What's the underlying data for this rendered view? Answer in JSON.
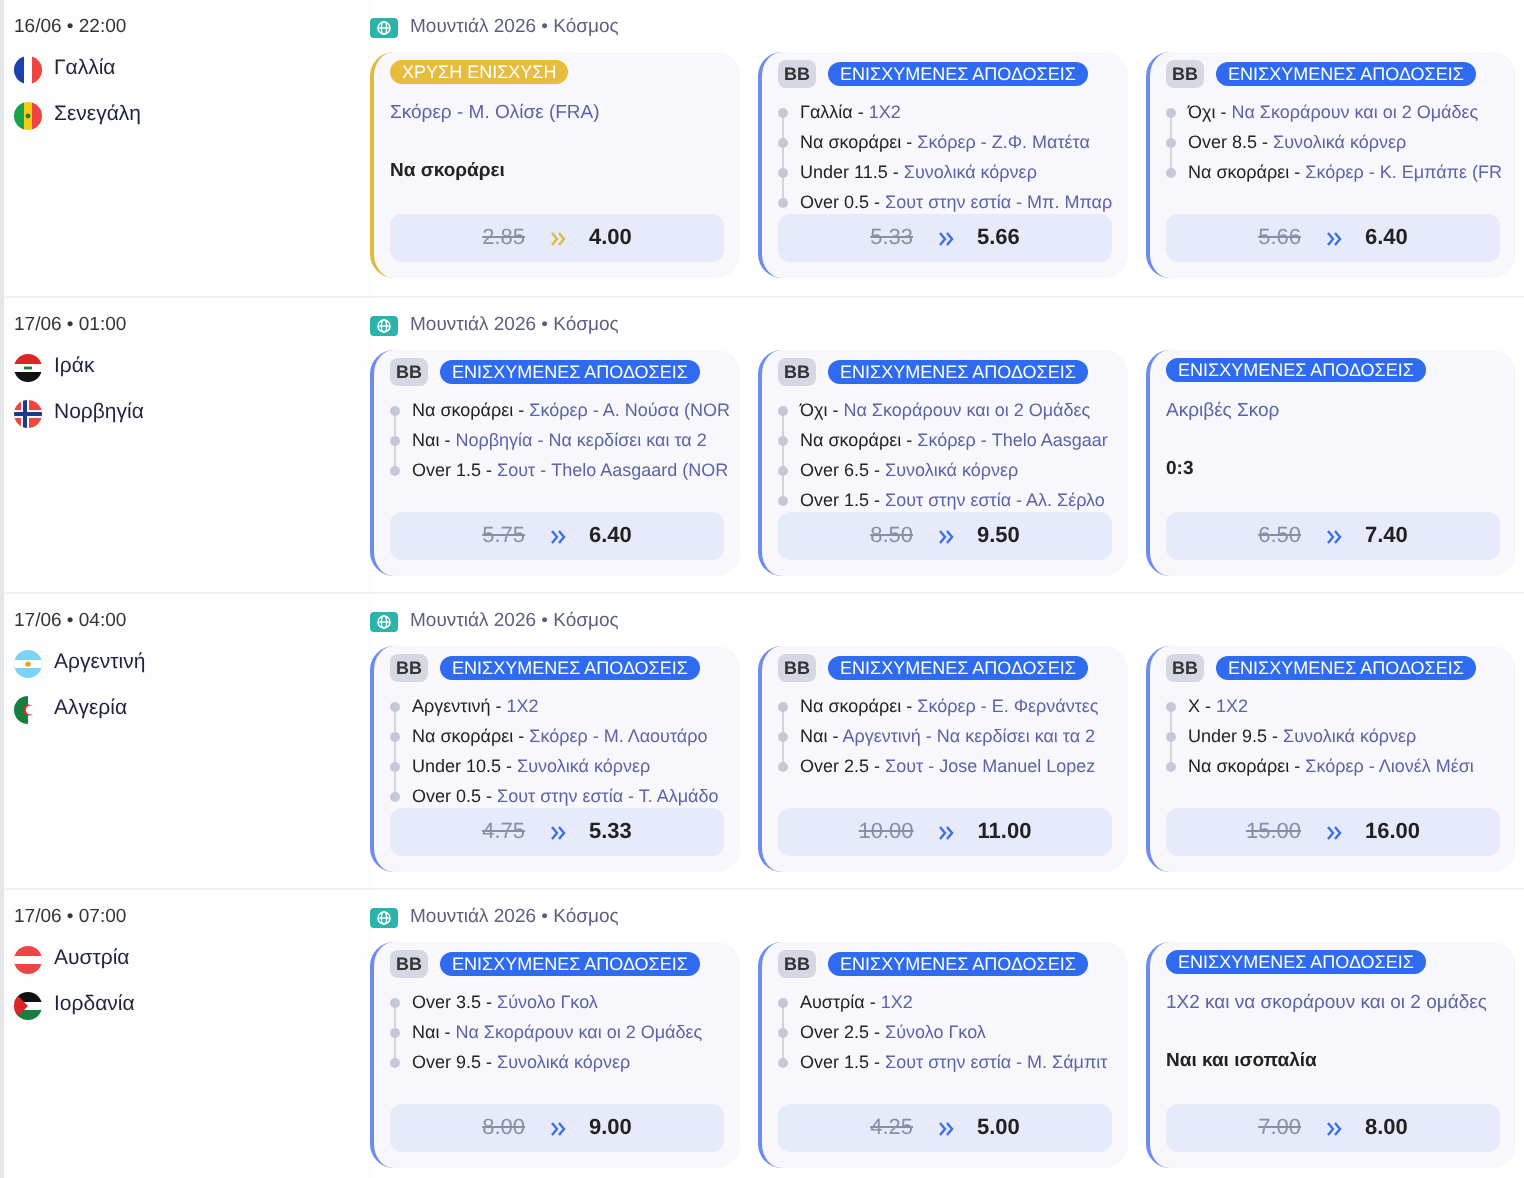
{
  "matches": [
    {
      "date": "16/06 • 22:00",
      "teams": [
        {
          "name": "Γαλλία",
          "kind": "fr"
        },
        {
          "name": "Σενεγάλη",
          "kind": "sn"
        }
      ],
      "competition": "Μουντιάλ 2026 • Κόσμος",
      "cards": [
        {
          "kind": "golden",
          "badge": "ΧΡΥΣΗ ΕΝΙΣΧΥΣΗ",
          "market": "Σκόρερ - Μ. Ολίσε (FRA)",
          "selection": "Να σκοράρει",
          "old_odds": "2.85",
          "new_odds": "4.00"
        },
        {
          "kind": "boosted",
          "bb": "BB",
          "badge": "ΕΝΙΣΧΥΜΕΝΕΣ ΑΠΟΔΟΣΕΙΣ",
          "legs": [
            {
              "pick": "Γαλλία -",
              "market": "1X2"
            },
            {
              "pick": "Να σκοράρει -",
              "market": "Σκόρερ - Ζ.Φ. Ματέτα"
            },
            {
              "pick": "Under 11.5 -",
              "market": "Συνολικά κόρνερ"
            },
            {
              "pick": "Over 0.5 -",
              "market": "Σουτ στην εστία - Μπ. Μπαρ"
            }
          ],
          "old_odds": "5.33",
          "new_odds": "5.66"
        },
        {
          "kind": "boosted",
          "bb": "BB",
          "badge": "ΕΝΙΣΧΥΜΕΝΕΣ ΑΠΟΔΟΣΕΙΣ",
          "legs": [
            {
              "pick": "Όχι -",
              "market": "Να Σκοράρουν και οι 2 Ομάδες"
            },
            {
              "pick": "Over 8.5 -",
              "market": "Συνολικά κόρνερ"
            },
            {
              "pick": "Να σκοράρει -",
              "market": "Σκόρερ - Κ. Εμπάπε (FR"
            }
          ],
          "old_odds": "5.66",
          "new_odds": "6.40"
        }
      ]
    },
    {
      "date": "17/06 • 01:00",
      "teams": [
        {
          "name": "Ιράκ",
          "kind": "iq"
        },
        {
          "name": "Νορβηγία",
          "kind": "no"
        }
      ],
      "competition": "Μουντιάλ 2026 • Κόσμος",
      "cards": [
        {
          "kind": "boosted",
          "bb": "BB",
          "badge": "ΕΝΙΣΧΥΜΕΝΕΣ ΑΠΟΔΟΣΕΙΣ",
          "legs": [
            {
              "pick": "Να σκοράρει -",
              "market": "Σκόρερ - Α. Νούσα (NOR"
            },
            {
              "pick": "Ναι -",
              "market": "Νορβηγία - Να κερδίσει και τα 2"
            },
            {
              "pick": "Over 1.5 -",
              "market": "Σουτ - Thelo Aasgaard (NOR"
            }
          ],
          "old_odds": "5.75",
          "new_odds": "6.40"
        },
        {
          "kind": "boosted",
          "bb": "BB",
          "badge": "ΕΝΙΣΧΥΜΕΝΕΣ ΑΠΟΔΟΣΕΙΣ",
          "legs": [
            {
              "pick": "Όχι -",
              "market": "Να Σκοράρουν και οι 2 Ομάδες"
            },
            {
              "pick": "Να σκοράρει -",
              "market": "Σκόρερ - Thelo Aasgaar"
            },
            {
              "pick": "Over 6.5 -",
              "market": "Συνολικά κόρνερ"
            },
            {
              "pick": "Over 1.5 -",
              "market": "Σουτ στην εστία - Αλ. Σέρλο"
            }
          ],
          "old_odds": "8.50",
          "new_odds": "9.50"
        },
        {
          "kind": "boosted",
          "badge": "ΕΝΙΣΧΥΜΕΝΕΣ ΑΠΟΔΟΣΕΙΣ",
          "market": "Ακριβές Σκορ",
          "selection": "0:3",
          "old_odds": "6.50",
          "new_odds": "7.40"
        }
      ]
    },
    {
      "date": "17/06 • 04:00",
      "teams": [
        {
          "name": "Αργεντινή",
          "kind": "ar"
        },
        {
          "name": "Αλγερία",
          "kind": "dz"
        }
      ],
      "competition": "Μουντιάλ 2026 • Κόσμος",
      "cards": [
        {
          "kind": "boosted",
          "bb": "BB",
          "badge": "ΕΝΙΣΧΥΜΕΝΕΣ ΑΠΟΔΟΣΕΙΣ",
          "legs": [
            {
              "pick": "Αργεντινή -",
              "market": "1X2"
            },
            {
              "pick": "Να σκοράρει -",
              "market": "Σκόρερ - Μ. Λαουτάρο"
            },
            {
              "pick": "Under 10.5 -",
              "market": "Συνολικά κόρνερ"
            },
            {
              "pick": "Over 0.5 -",
              "market": "Σουτ στην εστία - Τ. Αλμάδο"
            }
          ],
          "old_odds": "4.75",
          "new_odds": "5.33"
        },
        {
          "kind": "boosted",
          "bb": "BB",
          "badge": "ΕΝΙΣΧΥΜΕΝΕΣ ΑΠΟΔΟΣΕΙΣ",
          "legs": [
            {
              "pick": "Να σκοράρει -",
              "market": "Σκόρερ - Ε. Φερνάντες"
            },
            {
              "pick": "Ναι -",
              "market": "Αργεντινή - Να κερδίσει και τα 2"
            },
            {
              "pick": "Over 2.5 -",
              "market": "Σουτ - Jose Manuel Lopez"
            }
          ],
          "old_odds": "10.00",
          "new_odds": "11.00"
        },
        {
          "kind": "boosted",
          "bb": "BB",
          "badge": "ΕΝΙΣΧΥΜΕΝΕΣ ΑΠΟΔΟΣΕΙΣ",
          "legs": [
            {
              "pick": "X -",
              "market": "1X2"
            },
            {
              "pick": "Under 9.5 -",
              "market": "Συνολικά κόρνερ"
            },
            {
              "pick": "Να σκοράρει -",
              "market": "Σκόρερ - Λιονέλ Μέσι"
            }
          ],
          "old_odds": "15.00",
          "new_odds": "16.00"
        }
      ]
    },
    {
      "date": "17/06 • 07:00",
      "teams": [
        {
          "name": "Αυστρία",
          "kind": "at"
        },
        {
          "name": "Ιορδανία",
          "kind": "jo"
        }
      ],
      "competition": "Μουντιάλ 2026 • Κόσμος",
      "cards": [
        {
          "kind": "boosted",
          "bb": "BB",
          "badge": "ΕΝΙΣΧΥΜΕΝΕΣ ΑΠΟΔΟΣΕΙΣ",
          "legs": [
            {
              "pick": "Over 3.5 -",
              "market": "Σύνολο Γκολ"
            },
            {
              "pick": "Ναι -",
              "market": "Να Σκοράρουν και οι 2 Ομάδες"
            },
            {
              "pick": "Over 9.5 -",
              "market": "Συνολικά κόρνερ"
            }
          ],
          "old_odds": "8.00",
          "new_odds": "9.00"
        },
        {
          "kind": "boosted",
          "bb": "BB",
          "badge": "ΕΝΙΣΧΥΜΕΝΕΣ ΑΠΟΔΟΣΕΙΣ",
          "legs": [
            {
              "pick": "Αυστρία -",
              "market": "1X2"
            },
            {
              "pick": "Over 2.5 -",
              "market": "Σύνολο Γκολ"
            },
            {
              "pick": "Over 1.5 -",
              "market": "Σουτ στην εστία - Μ. Σάμπιτ"
            }
          ],
          "old_odds": "4.25",
          "new_odds": "5.00"
        },
        {
          "kind": "boosted",
          "badge": "ΕΝΙΣΧΥΜΕΝΕΣ ΑΠΟΔΟΣΕΙΣ",
          "market": "1X2 και να σκοράρουν και οι 2 ομάδες",
          "selection": "Ναι και ισοπαλία",
          "old_odds": "7.00",
          "new_odds": "8.00"
        }
      ]
    }
  ]
}
